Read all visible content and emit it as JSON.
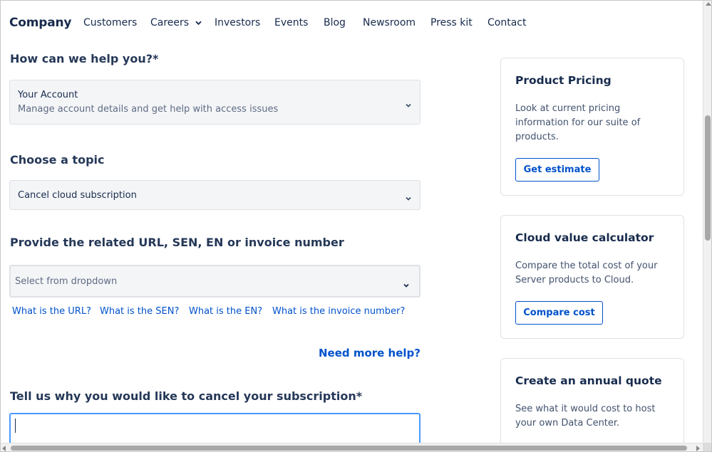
{
  "nav": {
    "logo": "Company",
    "items": [
      "Customers",
      "Careers",
      "Investors",
      "Events",
      "Blog",
      "Newsroom",
      "Press kit",
      "Contact"
    ]
  },
  "form": {
    "help_label": "How can we help you?*",
    "help_select": {
      "title": "Your Account",
      "subtitle": "Manage account details and get help with access issues"
    },
    "topic_label": "Choose a topic",
    "topic_select": "Cancel cloud subscription",
    "url_label": "Provide the related URL, SEN, EN or invoice number",
    "url_select_placeholder": "Select from dropdown",
    "help_links": [
      "What is the URL?",
      "What is the SEN?",
      "What is the EN?",
      "What is the invoice number?"
    ],
    "need_more_help": "Need more help?",
    "reason_label": "Tell us why you would like to cancel your subscription*"
  },
  "cards": [
    {
      "title": "Product Pricing",
      "text": "Look at current pricing information for our suite of products.",
      "button": "Get estimate"
    },
    {
      "title": "Cloud value calculator",
      "text": "Compare the total cost of your Server products to Cloud.",
      "button": "Compare cost"
    },
    {
      "title": "Create an annual quote",
      "text": "See what it would cost to host your own Data Center."
    }
  ],
  "colors": {
    "link": "#0052cc",
    "heading": "#172b4d",
    "focus_border": "#4c9aff"
  }
}
